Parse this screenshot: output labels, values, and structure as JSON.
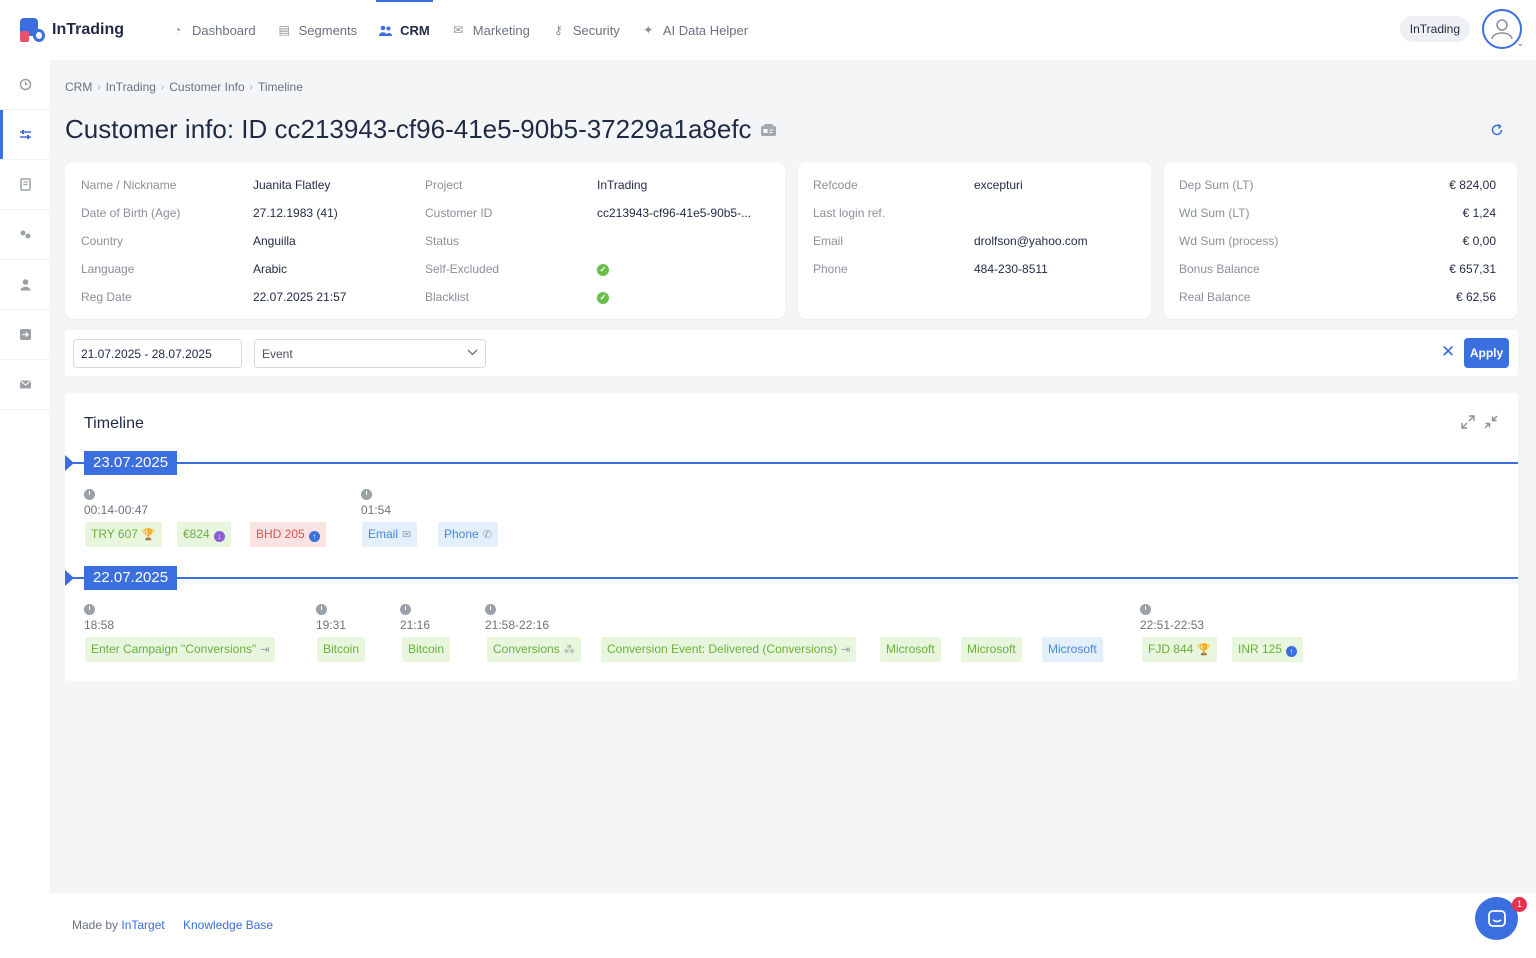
{
  "brand": {
    "name": "InTrading",
    "accent": "#3b6fe0"
  },
  "nav": {
    "items": [
      {
        "label": "Dashboard",
        "icon": "pie-chart-icon"
      },
      {
        "label": "Segments",
        "icon": "segments-icon"
      },
      {
        "label": "CRM",
        "icon": "users-icon",
        "active": true
      },
      {
        "label": "Marketing",
        "icon": "envelope-icon"
      },
      {
        "label": "Security",
        "icon": "key-icon"
      },
      {
        "label": "AI Data Helper",
        "icon": "sparkle-icon"
      }
    ],
    "workspace": "InTrading"
  },
  "sidebar": {
    "items": [
      {
        "icon": "clock-icon"
      },
      {
        "icon": "sliders-icon",
        "active": true
      },
      {
        "icon": "book-icon"
      },
      {
        "icon": "coins-icon"
      },
      {
        "icon": "user-icon"
      },
      {
        "icon": "sign-in-icon"
      },
      {
        "icon": "mail-icon"
      }
    ]
  },
  "breadcrumb": [
    "CRM",
    "InTrading",
    "Customer Info",
    "Timeline"
  ],
  "page_title": "Customer info: ID cc213943-cf96-41e5-90b5-37229a1a8efc",
  "customer": {
    "left_labels": [
      "Name / Nickname",
      "Date of Birth (Age)",
      "Country",
      "Language",
      "Reg Date"
    ],
    "left_values": [
      "Juanita Flatley",
      "27.12.1983 (41)",
      "Anguilla",
      "Arabic",
      "22.07.2025 21:57"
    ],
    "mid_labels": [
      "Project",
      "Customer ID",
      "Status",
      "Self-Excluded",
      "Blacklist"
    ],
    "mid_values": [
      "InTrading",
      "cc213943-cf96-41e5-90b5-...",
      "",
      "",
      ""
    ],
    "self_excluded_check": "✓",
    "blacklist_check": "✓"
  },
  "contact": {
    "labels": [
      "Refcode",
      "Last login ref.",
      "Email",
      "Phone"
    ],
    "values": [
      "excepturi",
      "",
      "drolfson@yahoo.com",
      "484-230-8511"
    ]
  },
  "balances": {
    "labels": [
      "Dep Sum (LT)",
      "Wd Sum (LT)",
      "Wd Sum (process)",
      "Bonus Balance",
      "Real Balance"
    ],
    "values": [
      "€ 824,00",
      "€ 1,24",
      "€ 0,00",
      "€ 657,31",
      "€ 62,56"
    ]
  },
  "filter": {
    "date_range": "21.07.2025 - 28.07.2025",
    "event_select": "Event",
    "apply_label": "Apply"
  },
  "timeline": {
    "title": "Timeline",
    "days": [
      {
        "date": "23.07.2025",
        "times": [
          "00:14-00:47",
          "01:54"
        ],
        "chips": [
          {
            "label": "TRY 607",
            "color": "red-trophy",
            "icon": "trophy-icon"
          },
          {
            "label": "€824",
            "icon": "deposit-icon"
          },
          {
            "label": "BHD 205",
            "icon": "withdraw-icon"
          },
          {
            "label": "Email",
            "icon": "envelope-icon"
          },
          {
            "label": "Phone",
            "icon": "phone-icon"
          }
        ]
      },
      {
        "date": "22.07.2025",
        "times": [
          "18:58",
          "19:31",
          "21:16",
          "21:58-22:16",
          "22:51-22:53"
        ],
        "chips": [
          {
            "label": "Enter Campaign \"Conversions\"",
            "icon": "sign-in-icon"
          },
          {
            "label": "Bitcoin"
          },
          {
            "label": "Bitcoin"
          },
          {
            "label": "Conversions",
            "icon": "nodes-icon"
          },
          {
            "label": "Conversion Event: Delivered (Conversions)",
            "icon": "sign-in-icon"
          },
          {
            "label": "Microsoft"
          },
          {
            "label": "Microsoft"
          },
          {
            "label": "Microsoft"
          },
          {
            "label": "FJD 844",
            "icon": "trophy-icon"
          },
          {
            "label": "INR 125",
            "icon": "withdraw-icon"
          }
        ]
      }
    ]
  },
  "footer": {
    "made_by_prefix": "Made by ",
    "made_by_link": "InTarget",
    "knowledge_base": "Knowledge Base"
  },
  "chat": {
    "badge": "1"
  }
}
